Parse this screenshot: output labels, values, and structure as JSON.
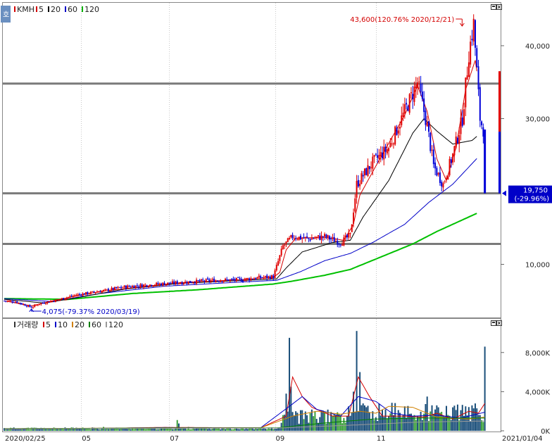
{
  "toolbar": {
    "price_legend": [
      {
        "label": "KMH",
        "color": "#d40000"
      },
      {
        "label": "5",
        "color": "#d40000"
      },
      {
        "label": "20",
        "color": "#000000"
      },
      {
        "label": "60",
        "color": "#0000c8"
      },
      {
        "label": "120",
        "color": "#00b000"
      }
    ],
    "volume_title": "거래량",
    "volume_legend": [
      {
        "label": "5",
        "color": "#d40000"
      },
      {
        "label": "10",
        "color": "#0000c8"
      },
      {
        "label": "20",
        "color": "#d08000"
      },
      {
        "label": "60",
        "color": "#008000"
      },
      {
        "label": "120",
        "color": "#999999"
      }
    ],
    "side_tab": "호"
  },
  "chart_data": {
    "type": "candlestick",
    "price": {
      "y_ticks": [
        "40,000",
        "30,000",
        "10,000"
      ],
      "ylim": [
        3000,
        45500
      ],
      "high_annotation": "43,600(120.76% 2020/12/21)",
      "low_annotation": "4,075(-79.37% 2020/03/19)",
      "current_label": "19,750",
      "current_change": "(-29.96%)",
      "horizontal_lines": [
        34800,
        19750,
        12800
      ],
      "colors": {
        "up": "#e00000",
        "down": "#0000d8",
        "ma5": "#d40000",
        "ma20": "#000000",
        "ma60": "#0000c8",
        "ma120": "#00c000"
      },
      "series_keyframes": {
        "close": [
          [
            0,
            5000
          ],
          [
            7,
            4900
          ],
          [
            17,
            4100
          ],
          [
            22,
            4600
          ],
          [
            33,
            5100
          ],
          [
            45,
            5800
          ],
          [
            60,
            6300
          ],
          [
            75,
            6900
          ],
          [
            90,
            7200
          ],
          [
            110,
            7500
          ],
          [
            130,
            7800
          ],
          [
            148,
            7900
          ],
          [
            160,
            8200
          ],
          [
            168,
            8300
          ],
          [
            174,
            12500
          ],
          [
            180,
            13800
          ],
          [
            190,
            13500
          ],
          [
            200,
            13800
          ],
          [
            210,
            13000
          ],
          [
            216,
            14000
          ],
          [
            220,
            21000
          ],
          [
            230,
            24000
          ],
          [
            240,
            26000
          ],
          [
            250,
            31000
          ],
          [
            258,
            35000
          ],
          [
            264,
            29000
          ],
          [
            268,
            23500
          ],
          [
            274,
            21000
          ],
          [
            280,
            25000
          ],
          [
            286,
            30000
          ],
          [
            290,
            39000
          ],
          [
            293,
            43000
          ],
          [
            297,
            30000
          ],
          [
            299,
            28500
          ],
          [
            300,
            19750
          ]
        ],
        "ma5": [
          [
            0,
            5000
          ],
          [
            17,
            4300
          ],
          [
            30,
            5000
          ],
          [
            60,
            6300
          ],
          [
            110,
            7500
          ],
          [
            148,
            7900
          ],
          [
            168,
            8200
          ],
          [
            172,
            8900
          ],
          [
            176,
            12000
          ],
          [
            182,
            13600
          ],
          [
            200,
            13700
          ],
          [
            212,
            13300
          ],
          [
            218,
            15500
          ],
          [
            222,
            19500
          ],
          [
            232,
            23500
          ],
          [
            250,
            30500
          ],
          [
            258,
            34500
          ],
          [
            264,
            31000
          ],
          [
            270,
            24500
          ],
          [
            276,
            21500
          ],
          [
            282,
            26000
          ],
          [
            288,
            34000
          ],
          [
            294,
            38000
          ],
          [
            297,
            33500
          ],
          [
            300,
            30000
          ]
        ],
        "ma20": [
          [
            0,
            5200
          ],
          [
            25,
            4700
          ],
          [
            45,
            5400
          ],
          [
            75,
            6600
          ],
          [
            110,
            7400
          ],
          [
            150,
            7800
          ],
          [
            170,
            8000
          ],
          [
            176,
            9500
          ],
          [
            186,
            11700
          ],
          [
            205,
            13000
          ],
          [
            216,
            13300
          ],
          [
            224,
            16500
          ],
          [
            240,
            21500
          ],
          [
            255,
            28000
          ],
          [
            262,
            30000
          ],
          [
            270,
            28300
          ],
          [
            280,
            26500
          ],
          [
            292,
            27000
          ],
          [
            300,
            28500
          ]
        ],
        "ma60": [
          [
            0,
            5300
          ],
          [
            30,
            4900
          ],
          [
            60,
            6000
          ],
          [
            100,
            7000
          ],
          [
            150,
            7600
          ],
          [
            170,
            7800
          ],
          [
            185,
            9000
          ],
          [
            200,
            10500
          ],
          [
            216,
            11500
          ],
          [
            230,
            13000
          ],
          [
            250,
            15500
          ],
          [
            265,
            18500
          ],
          [
            280,
            21000
          ],
          [
            300,
            25700
          ]
        ],
        "ma120": [
          [
            0,
            5300
          ],
          [
            40,
            5200
          ],
          [
            80,
            6000
          ],
          [
            120,
            6500
          ],
          [
            150,
            7000
          ],
          [
            168,
            7300
          ],
          [
            180,
            7700
          ],
          [
            200,
            8500
          ],
          [
            216,
            9300
          ],
          [
            235,
            11000
          ],
          [
            255,
            12800
          ],
          [
            270,
            14500
          ],
          [
            290,
            16500
          ],
          [
            300,
            17500
          ]
        ]
      }
    },
    "volume": {
      "y_ticks": [
        "8,000K",
        "4,000K",
        "0K"
      ],
      "ylim": [
        0,
        10500
      ],
      "spikes": [
        [
          62,
          400
        ],
        [
          108,
          1100
        ],
        [
          109,
          750
        ],
        [
          115,
          400
        ],
        [
          125,
          250
        ],
        [
          176,
          3800
        ],
        [
          178,
          9500
        ],
        [
          179,
          4500
        ],
        [
          182,
          2000
        ],
        [
          187,
          1200
        ],
        [
          193,
          1500
        ],
        [
          215,
          2500
        ],
        [
          218,
          4000
        ],
        [
          220,
          10200
        ],
        [
          222,
          6000
        ],
        [
          224,
          2800
        ],
        [
          230,
          2000
        ],
        [
          240,
          1500
        ],
        [
          250,
          2500
        ],
        [
          258,
          1500
        ],
        [
          264,
          3500
        ],
        [
          270,
          2600
        ],
        [
          280,
          2400
        ],
        [
          288,
          2500
        ],
        [
          292,
          2600
        ],
        [
          300,
          8600
        ]
      ],
      "ma_keyframes": {
        "ma5": [
          [
            0,
            200
          ],
          [
            60,
            250
          ],
          [
            100,
            350
          ],
          [
            160,
            300
          ],
          [
            176,
            1500
          ],
          [
            180,
            5500
          ],
          [
            186,
            3500
          ],
          [
            192,
            2400
          ],
          [
            205,
            1500
          ],
          [
            215,
            1500
          ],
          [
            221,
            5500
          ],
          [
            228,
            3500
          ],
          [
            236,
            1500
          ],
          [
            250,
            1500
          ],
          [
            262,
            1400
          ],
          [
            270,
            1800
          ],
          [
            280,
            1200
          ],
          [
            290,
            2000
          ],
          [
            296,
            1800
          ],
          [
            300,
            2800
          ]
        ],
        "ma10": [
          [
            0,
            200
          ],
          [
            60,
            260
          ],
          [
            100,
            330
          ],
          [
            160,
            300
          ],
          [
            178,
            2500
          ],
          [
            186,
            3500
          ],
          [
            195,
            2200
          ],
          [
            210,
            1500
          ],
          [
            221,
            3500
          ],
          [
            232,
            3000
          ],
          [
            242,
            1800
          ],
          [
            255,
            1500
          ],
          [
            270,
            1600
          ],
          [
            285,
            1300
          ],
          [
            300,
            1900
          ]
        ],
        "ma20": [
          [
            0,
            220
          ],
          [
            100,
            300
          ],
          [
            160,
            300
          ],
          [
            180,
            1500
          ],
          [
            195,
            2000
          ],
          [
            210,
            1700
          ],
          [
            222,
            2000
          ],
          [
            232,
            1800
          ],
          [
            240,
            2500
          ],
          [
            255,
            2400
          ],
          [
            270,
            1400
          ],
          [
            290,
            1200
          ],
          [
            300,
            1400
          ]
        ],
        "ma60": [
          [
            0,
            220
          ],
          [
            100,
            280
          ],
          [
            170,
            300
          ],
          [
            200,
            800
          ],
          [
            230,
            1200
          ],
          [
            260,
            1300
          ],
          [
            300,
            1300
          ]
        ],
        "ma120": [
          [
            0,
            200
          ],
          [
            100,
            250
          ],
          [
            170,
            280
          ],
          [
            220,
            600
          ],
          [
            260,
            900
          ],
          [
            300,
            1000
          ]
        ]
      }
    },
    "x_ticks": [
      {
        "label": "2020/02/25",
        "idx": 0
      },
      {
        "label": "05",
        "idx": 48
      },
      {
        "label": "07",
        "idx": 103
      },
      {
        "label": "09",
        "idx": 169
      },
      {
        "label": "11",
        "idx": 232
      },
      {
        "label": "2021/01/04",
        "idx": 305
      }
    ],
    "x_range": [
      0,
      305
    ]
  }
}
